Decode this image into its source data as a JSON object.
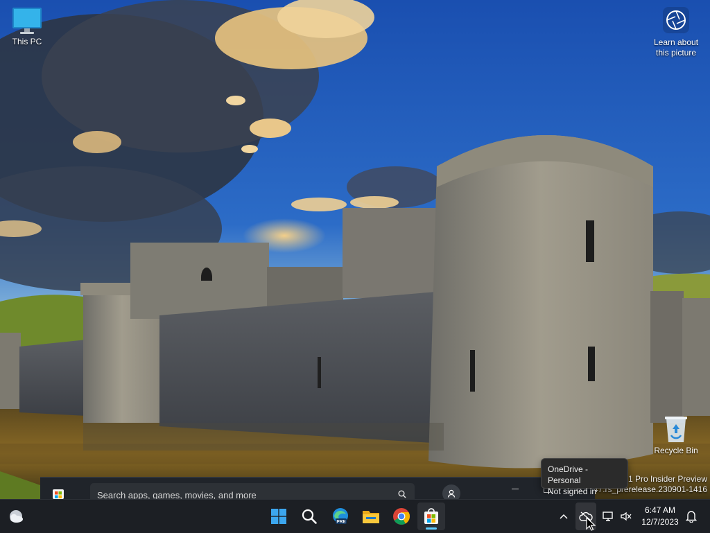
{
  "desktop": {
    "icons": [
      {
        "label": "This PC",
        "icon": "monitor-icon"
      },
      {
        "label": "Recycle Bin",
        "icon": "recycle-bin-icon"
      }
    ],
    "spotlight": {
      "line1": "Learn about",
      "line2": "this picture",
      "icon": "camera-aperture-icon"
    },
    "watermark": {
      "line1": "1 Pro Insider Preview",
      "line2": "947.rs_prerelease.230901-1416"
    }
  },
  "store_window": {
    "search_placeholder": "Search apps, games, movies, and more",
    "icons": [
      "store-logo-icon",
      "search-icon",
      "person-icon",
      "minimize-icon",
      "maximize-icon",
      "close-icon"
    ]
  },
  "tooltip": {
    "title": "OneDrive - Personal",
    "status": "Not signed in"
  },
  "taskbar": {
    "pinned": [
      "Start",
      "Search",
      "Microsoft Edge Preview",
      "File Explorer",
      "Google Chrome",
      "Microsoft Store"
    ],
    "edge_badge": "PRE",
    "active_app": "Microsoft Store",
    "tray_icons": [
      "chevron-up-icon",
      "onedrive-cloud-icon",
      "network-icon",
      "volume-muted-icon",
      "notification-bell-icon"
    ],
    "clock": {
      "time": "6:47 AM",
      "date": "12/7/2023"
    }
  },
  "colors": {
    "taskbar_bg": "#1c1f24",
    "accent": "#60cdff",
    "store_bar_bg": "#20242a",
    "tooltip_bg": "#2b2b2b"
  }
}
